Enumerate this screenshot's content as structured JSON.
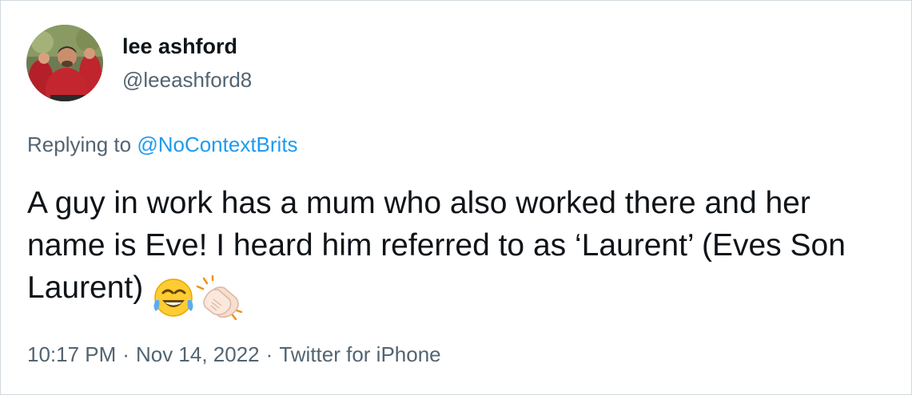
{
  "author": {
    "display_name": "lee ashford",
    "handle": "@leeashford8",
    "avatar": "profile-photo"
  },
  "reply": {
    "prefix": "Replying to",
    "to_handle": "@NoContextBrits"
  },
  "tweet": {
    "text": "A guy in work has a mum who also worked there and her name is Eve! I heard him referred to as ‘Laurent’ (Eves Son Laurent)",
    "emojis": [
      "face-with-tears-of-joy",
      "clapping-hands-light-skin-tone"
    ]
  },
  "meta": {
    "time": "10:17 PM",
    "separator": "·",
    "date": "Nov 14, 2022",
    "source": "Twitter for iPhone"
  },
  "colors": {
    "text": "#0f1419",
    "secondary": "#536471",
    "link": "#1d9bf0",
    "border": "#cfd9de"
  }
}
